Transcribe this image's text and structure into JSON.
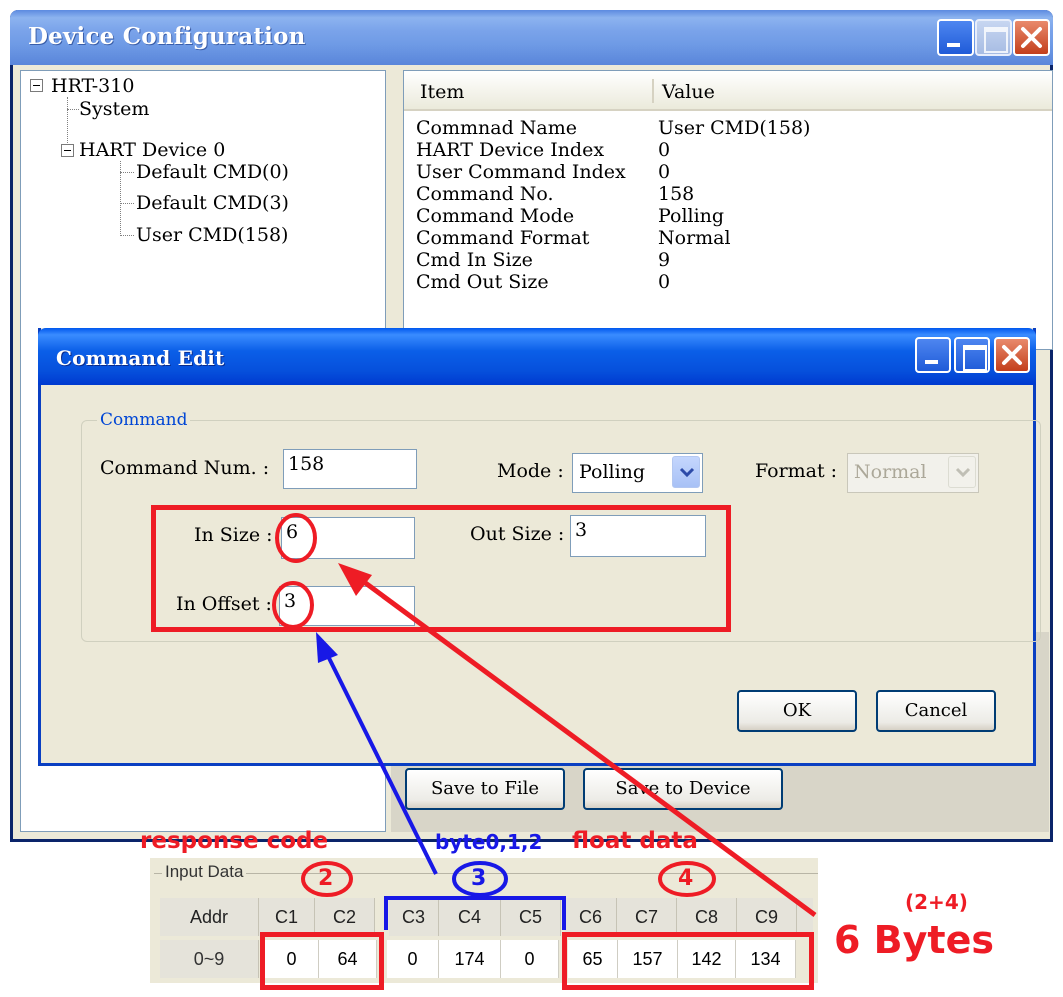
{
  "device_window": {
    "title": "Device Configuration",
    "tree": {
      "root": "HRT-310",
      "system": "System",
      "device": "HART Device 0",
      "children": [
        "Default CMD(0)",
        "Default CMD(3)",
        "User CMD(158)"
      ]
    },
    "list": {
      "headers": {
        "item": "Item",
        "value": "Value"
      },
      "rows": [
        {
          "item": "Commnad Name",
          "value": "User CMD(158)"
        },
        {
          "item": "HART Device Index",
          "value": "0"
        },
        {
          "item": "User Command Index",
          "value": "0"
        },
        {
          "item": "Command No.",
          "value": "158"
        },
        {
          "item": "Command Mode",
          "value": "Polling"
        },
        {
          "item": "Command Format",
          "value": "Normal"
        },
        {
          "item": "Cmd In Size",
          "value": "9"
        },
        {
          "item": "Cmd Out Size",
          "value": "0"
        }
      ]
    },
    "buttons": {
      "save_file": "Save to File",
      "save_device": "Save to Device"
    }
  },
  "command_edit": {
    "title": "Command Edit",
    "group_label": "Command",
    "command_num_label": "Command Num. :",
    "command_num_value": "158",
    "mode_label": "Mode :",
    "mode_value": "Polling",
    "format_label": "Format :",
    "format_value": "Normal",
    "in_size_label": "In Size :",
    "in_size_value": "6",
    "out_size_label": "Out Size :",
    "out_size_value": "3",
    "in_offset_label": "In Offset :",
    "in_offset_value": "3",
    "ok_label": "OK",
    "cancel_label": "Cancel"
  },
  "annotations": {
    "response_code": "response code",
    "byte012": "byte0,1,2",
    "float_data": "float data",
    "n2": "2",
    "n3": "3",
    "n4": "4",
    "sum": "(2+4)",
    "bytes": "6 Bytes"
  },
  "input_data": {
    "title": "Input Data",
    "headers": [
      "Addr",
      "C1",
      "C2",
      "C3",
      "C4",
      "C5",
      "C6",
      "C7",
      "C8",
      "C9"
    ],
    "row_label": "0~9",
    "values": [
      "0",
      "64",
      "0",
      "174",
      "0",
      "65",
      "157",
      "142",
      "134"
    ]
  },
  "colors": {
    "annotation_red": "#ee1c25",
    "annotation_blue": "#1818e6",
    "xp_title_blue": "#0058ee"
  }
}
